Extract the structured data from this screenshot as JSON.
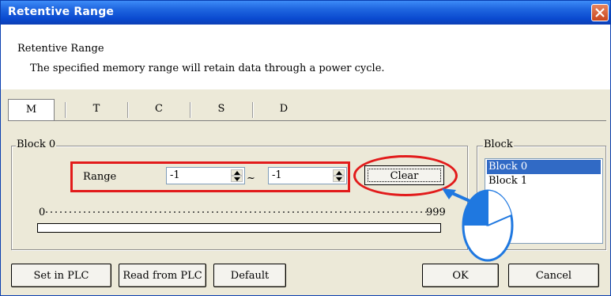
{
  "window": {
    "title": "Retentive Range"
  },
  "header": {
    "title": "Retentive Range",
    "description": "The specified memory range will retain data through a power cycle."
  },
  "tabs": [
    {
      "label": "M",
      "active": true
    },
    {
      "label": "T",
      "active": false
    },
    {
      "label": "C",
      "active": false
    },
    {
      "label": "S",
      "active": false
    },
    {
      "label": "D",
      "active": false
    }
  ],
  "block_group": {
    "legend": "Block 0",
    "range_label": "Range",
    "range_start": "-1",
    "range_separator": "~",
    "range_end": "-1",
    "clear_label": "Clear",
    "scale_min": "0",
    "scale_max": "999"
  },
  "block_list": {
    "legend": "Block",
    "items": [
      {
        "label": "Block 0",
        "selected": true
      },
      {
        "label": "Block 1",
        "selected": false
      }
    ]
  },
  "buttons": {
    "set_in_plc": "Set in PLC",
    "read_from_plc": "Read from PLC",
    "default": "Default",
    "ok": "OK",
    "cancel": "Cancel"
  },
  "colors": {
    "highlight": "#e21b1b",
    "pointer": "#1f78e0",
    "selection": "#316ac5"
  }
}
